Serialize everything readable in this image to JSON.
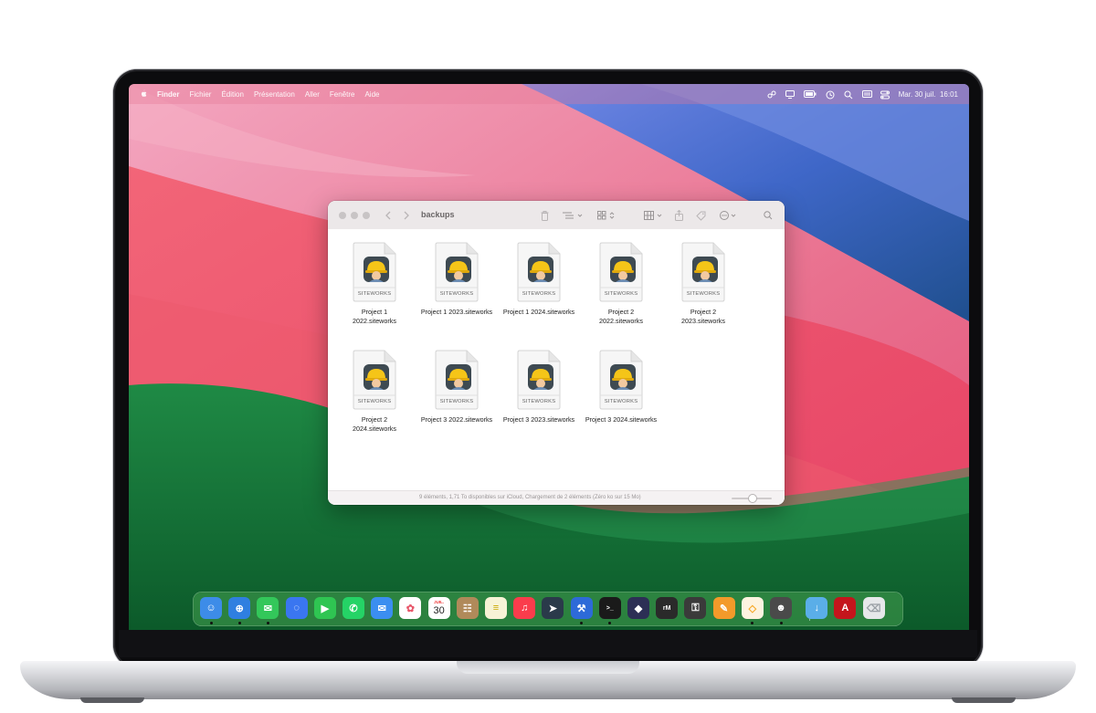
{
  "menubar": {
    "apple": "",
    "app": "Finder",
    "items": [
      "Fichier",
      "Édition",
      "Présentation",
      "Aller",
      "Fenêtre",
      "Aide"
    ],
    "clock": "Mar. 30 juil.  16:01",
    "status_icons": [
      "steam-icon",
      "screen-mirror-icon",
      "battery-icon",
      "time-machine-icon",
      "search-icon",
      "display-icon",
      "control-center-icon"
    ]
  },
  "finder": {
    "title": "backups",
    "toolbar_icons": [
      "back-icon",
      "forward-icon",
      "trash-icon",
      "list-view-icon",
      "icon-view-icon",
      "group-icon",
      "share-icon",
      "tag-icon",
      "more-icon",
      "search-icon"
    ],
    "files": [
      {
        "badge": "SITEWORKS",
        "line1": "Project 1",
        "line2": "2022.siteworks"
      },
      {
        "badge": "SITEWORKS",
        "line1": "Project 1 2023.siteworks",
        "line2": ""
      },
      {
        "badge": "SITEWORKS",
        "line1": "Project 1 2024.siteworks",
        "line2": ""
      },
      {
        "badge": "SITEWORKS",
        "line1": "Project  2",
        "line2": "2022.siteworks"
      },
      {
        "badge": "SITEWORKS",
        "line1": "Project  2",
        "line2": "2023.siteworks"
      },
      {
        "badge": "SITEWORKS",
        "line1": "Project  2",
        "line2": "2024.siteworks"
      },
      {
        "badge": "SITEWORKS",
        "line1": "Project 3 2022.siteworks",
        "line2": ""
      },
      {
        "badge": "SITEWORKS",
        "line1": "Project 3 2023.siteworks",
        "line2": ""
      },
      {
        "badge": "SITEWORKS",
        "line1": "Project 3 2024.siteworks",
        "line2": ""
      }
    ],
    "status": "9 éléments, 1,71 To disponibles sur iCloud, Chargement de 2 éléments (Zéro ko sur 15 Mo)"
  },
  "dock": {
    "calendar_month": "JUIL.",
    "calendar_day": "30",
    "apps": [
      {
        "name": "finder",
        "color": "#3d8ce8",
        "running": true
      },
      {
        "name": "safari",
        "color": "#2f7fe0",
        "running": true
      },
      {
        "name": "messages",
        "color": "#33c75a",
        "running": true
      },
      {
        "name": "signal",
        "color": "#3a76f0",
        "running": false
      },
      {
        "name": "facetime",
        "color": "#2fc552",
        "running": false
      },
      {
        "name": "whatsapp",
        "color": "#25d366",
        "running": false
      },
      {
        "name": "mail",
        "color": "#3b8ef0",
        "running": false
      },
      {
        "name": "photos",
        "color": "#ffffff",
        "running": false
      },
      {
        "name": "calendar",
        "color": "#ffffff",
        "running": false
      },
      {
        "name": "contacts",
        "color": "#b08a5a",
        "running": false
      },
      {
        "name": "notes",
        "color": "#f7f3d6",
        "running": false
      },
      {
        "name": "music",
        "color": "#fa3c4c",
        "running": false
      },
      {
        "name": "prompt",
        "color": "#2a3a4a",
        "running": false
      },
      {
        "name": "xcode",
        "color": "#2d6ad8",
        "running": true
      },
      {
        "name": "terminal",
        "color": "#1a1a1a",
        "running": true
      },
      {
        "name": "github-desktop",
        "color": "#2c2f55",
        "running": false
      },
      {
        "name": "remarkable",
        "color": "#2a2a2a",
        "running": false
      },
      {
        "name": "keychain",
        "color": "#3a3a3a",
        "running": false
      },
      {
        "name": "pages",
        "color": "#f39a2a",
        "running": false
      },
      {
        "name": "sketch",
        "color": "#fdf3e0",
        "running": true
      },
      {
        "name": "siteworks",
        "color": "#4a4a4a",
        "running": true
      },
      {
        "name": "downloads-folder",
        "color": "#5aaee8",
        "running": false
      },
      {
        "name": "acrobat",
        "color": "#c4151c",
        "running": false
      },
      {
        "name": "trash",
        "color": "#e6e8ea",
        "running": false
      }
    ]
  }
}
